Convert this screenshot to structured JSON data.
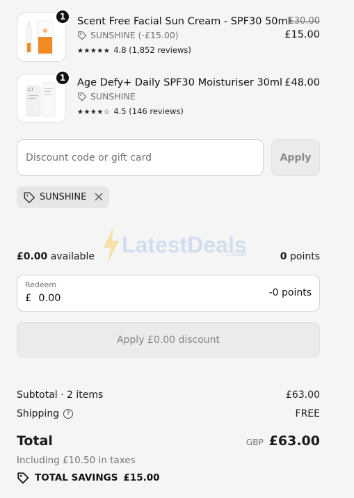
{
  "items": [
    {
      "name": "Scent Free Facial Sun Cream - SPF30 50ml",
      "quantity": "1",
      "discount_label": "SUNSHINE (-£15.00)",
      "stars": "★★★★★",
      "rating_text": "4.8 (1,852 reviews)",
      "original_price": "£30.00",
      "price": "£15.00"
    },
    {
      "name": "Age Defy+ Daily SPF30 Moisturiser 30ml",
      "quantity": "1",
      "discount_label": "SUNSHINE",
      "stars": "★★★★☆",
      "rating_text": "4.5 (146 reviews)",
      "price": "£48.00"
    }
  ],
  "discount": {
    "placeholder": "Discount code or gift card",
    "apply_label": "Apply",
    "applied_code": "SUNSHINE"
  },
  "watermark": {
    "text": "LatestDeals",
    "sub": ".co.uk"
  },
  "points": {
    "available_amount": "£0.00",
    "available_label": "available",
    "points_value": "0",
    "points_label": "points",
    "redeem_label": "Redeem",
    "currency_symbol": "£",
    "redeem_value": "0.00",
    "redeem_points": "-0 points",
    "apply_button": "Apply £0.00 discount"
  },
  "summary": {
    "subtotal_label": "Subtotal · 2 items",
    "subtotal_value": "£63.00",
    "shipping_label": "Shipping",
    "shipping_value": "FREE",
    "total_label": "Total",
    "currency": "GBP",
    "total_value": "£63.00",
    "tax_note": "Including £10.50 in taxes",
    "savings_label": "TOTAL SAVINGS",
    "savings_value": "£15.00"
  },
  "colors": {
    "background": "#f5f5f5",
    "sun_cream_orange": "#f08a24",
    "watermark_blue": "#a8c2e6",
    "watermark_bolt": "#f5c84a"
  }
}
